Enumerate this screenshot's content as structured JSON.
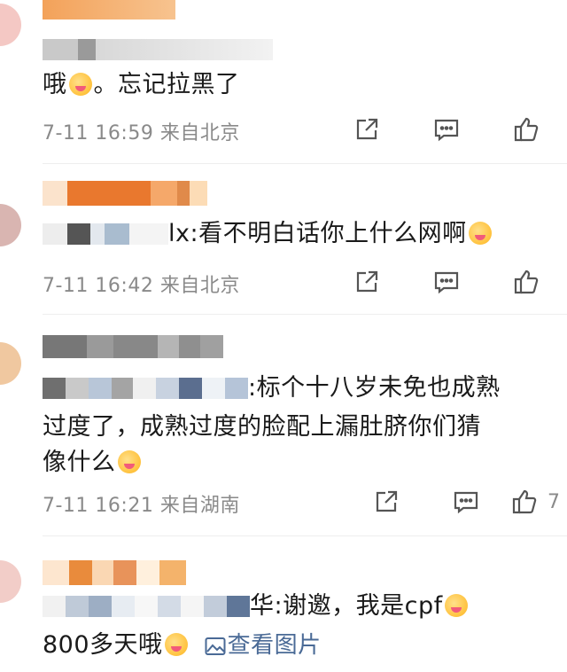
{
  "comments": [
    {
      "mention_prefix": "@",
      "text": "哦",
      "text_after": "。忘记拉黑了",
      "time": "7-11 16:59",
      "location": "来自北京",
      "likes": ""
    },
    {
      "mention_suffix": "lx:",
      "text": "看不明白话你上什么网啊",
      "time": "7-11 16:42",
      "location": "来自北京",
      "likes": ""
    },
    {
      "mention_suffix": ":",
      "line1": "标个十八岁未免也成熟",
      "line2": "过度了，成熟过度的脸配上漏肚脐你们猜",
      "line3": "像什么",
      "time": "7-11 16:21",
      "location": "来自湖南",
      "likes": "7"
    },
    {
      "mention_suffix": "华:",
      "line1": "谢邀，我是cpf",
      "line2": "800多天哦",
      "view_image": "查看图片"
    }
  ],
  "icons": [
    "share-icon",
    "comment-icon",
    "like-icon",
    "emoji-icon",
    "image-icon"
  ]
}
